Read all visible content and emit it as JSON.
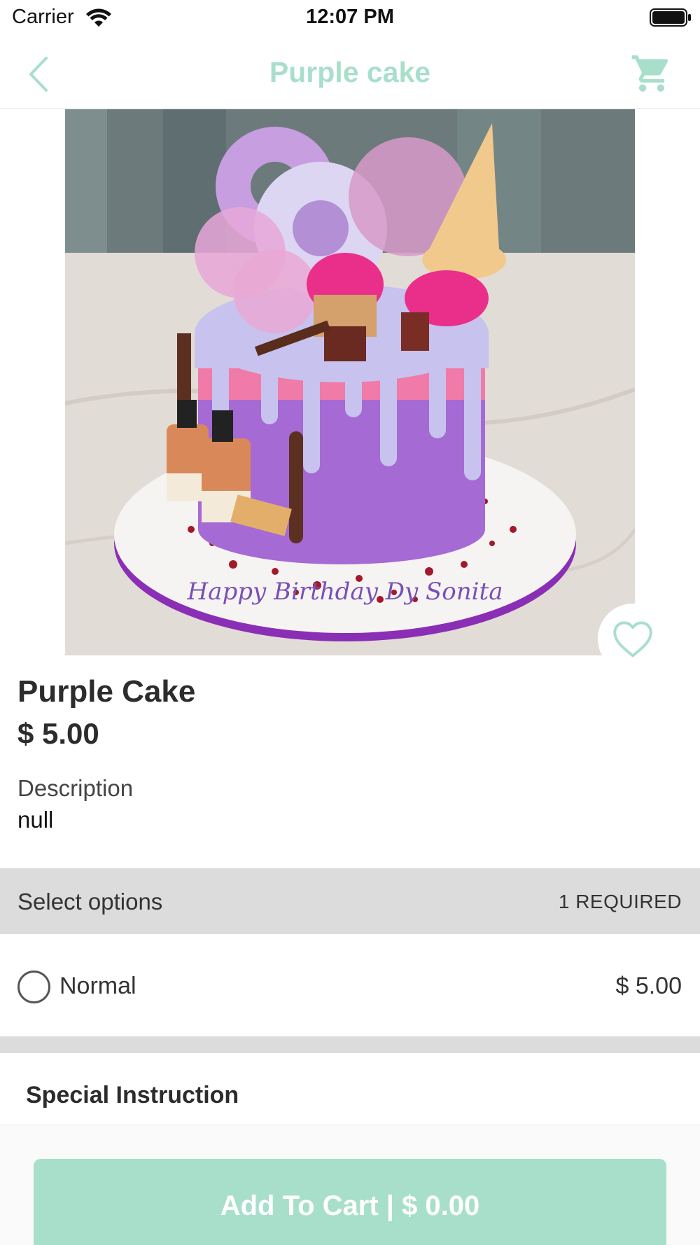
{
  "status_bar": {
    "carrier": "Carrier",
    "time": "12:07 PM",
    "icons": [
      "wifi-icon",
      "battery-icon"
    ]
  },
  "nav": {
    "title": "Purple cake",
    "back_icon": "chevron-left-icon",
    "cart_icon": "cart-icon",
    "accent_color": "#a8dfcb"
  },
  "product": {
    "image_icon": "cake-photo",
    "cake_inscription": "Happy Birthday Dy Sonita",
    "favorite_icon": "heart-icon",
    "name": "Purple Cake",
    "price": "$ 5.00",
    "description_label": "Description",
    "description_value": "null"
  },
  "options": {
    "title": "Select options",
    "required": "1 REQUIRED",
    "items": [
      {
        "label": "Normal",
        "price": "$ 5.00",
        "selected": false
      }
    ]
  },
  "special": {
    "title": "Special Instruction"
  },
  "footer": {
    "add_to_cart": "Add To Cart | $ 0.00"
  }
}
